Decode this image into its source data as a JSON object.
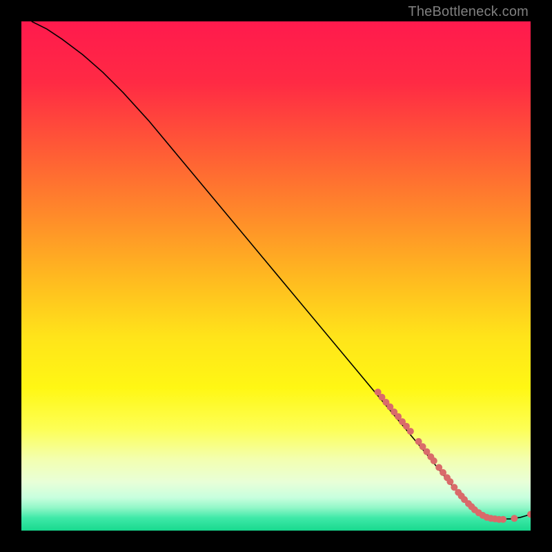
{
  "attribution": "TheBottleneck.com",
  "chart_data": {
    "type": "line",
    "title": "",
    "xlabel": "",
    "ylabel": "",
    "xlim": [
      0,
      100
    ],
    "ylim": [
      0,
      100
    ],
    "background_gradient": {
      "stops": [
        {
          "pos": 0.0,
          "color": "#ff1a4d"
        },
        {
          "pos": 0.12,
          "color": "#ff2a44"
        },
        {
          "pos": 0.25,
          "color": "#ff5a36"
        },
        {
          "pos": 0.38,
          "color": "#ff8a2a"
        },
        {
          "pos": 0.5,
          "color": "#ffb820"
        },
        {
          "pos": 0.62,
          "color": "#ffe41a"
        },
        {
          "pos": 0.72,
          "color": "#fff714"
        },
        {
          "pos": 0.8,
          "color": "#fdff55"
        },
        {
          "pos": 0.86,
          "color": "#f3ffb0"
        },
        {
          "pos": 0.905,
          "color": "#e8ffd8"
        },
        {
          "pos": 0.935,
          "color": "#c8ffde"
        },
        {
          "pos": 0.955,
          "color": "#92f7c8"
        },
        {
          "pos": 0.975,
          "color": "#3fe9a8"
        },
        {
          "pos": 1.0,
          "color": "#18d98e"
        }
      ]
    },
    "series": [
      {
        "name": "curve",
        "color": "#000000",
        "x": [
          2,
          5,
          8,
          12,
          16,
          20,
          25,
          30,
          35,
          40,
          45,
          50,
          55,
          60,
          65,
          70,
          75,
          80,
          84,
          86,
          88,
          90,
          92,
          94,
          96,
          98,
          100
        ],
        "y": [
          100,
          98.5,
          96.5,
          93.5,
          90,
          86,
          80.5,
          74.5,
          68.5,
          62.5,
          56.5,
          50.5,
          44.5,
          38.5,
          32.5,
          26.5,
          20.5,
          14.5,
          9.5,
          7.2,
          5.2,
          3.6,
          2.6,
          2.3,
          2.3,
          2.6,
          3.2
        ]
      }
    ],
    "scatter": {
      "name": "markers",
      "color": "#d96a6a",
      "radius_px": 5,
      "points": [
        {
          "x": 70.0,
          "y": 27.2
        },
        {
          "x": 70.8,
          "y": 26.2
        },
        {
          "x": 71.6,
          "y": 25.2
        },
        {
          "x": 72.4,
          "y": 24.3
        },
        {
          "x": 73.2,
          "y": 23.3
        },
        {
          "x": 74.0,
          "y": 22.4
        },
        {
          "x": 74.8,
          "y": 21.4
        },
        {
          "x": 75.6,
          "y": 20.5
        },
        {
          "x": 76.4,
          "y": 19.5
        },
        {
          "x": 78.0,
          "y": 17.5
        },
        {
          "x": 78.8,
          "y": 16.5
        },
        {
          "x": 79.6,
          "y": 15.5
        },
        {
          "x": 80.4,
          "y": 14.5
        },
        {
          "x": 81.0,
          "y": 13.7
        },
        {
          "x": 82.0,
          "y": 12.4
        },
        {
          "x": 82.8,
          "y": 11.4
        },
        {
          "x": 83.6,
          "y": 10.4
        },
        {
          "x": 84.2,
          "y": 9.6
        },
        {
          "x": 85.0,
          "y": 8.5
        },
        {
          "x": 85.8,
          "y": 7.5
        },
        {
          "x": 86.4,
          "y": 6.8
        },
        {
          "x": 87.0,
          "y": 6.1
        },
        {
          "x": 87.8,
          "y": 5.3
        },
        {
          "x": 88.4,
          "y": 4.7
        },
        {
          "x": 89.0,
          "y": 4.1
        },
        {
          "x": 89.8,
          "y": 3.5
        },
        {
          "x": 90.6,
          "y": 3.0
        },
        {
          "x": 91.4,
          "y": 2.6
        },
        {
          "x": 92.2,
          "y": 2.4
        },
        {
          "x": 93.0,
          "y": 2.3
        },
        {
          "x": 93.8,
          "y": 2.2
        },
        {
          "x": 94.6,
          "y": 2.2
        },
        {
          "x": 96.8,
          "y": 2.4
        },
        {
          "x": 100.0,
          "y": 3.2
        }
      ]
    }
  }
}
